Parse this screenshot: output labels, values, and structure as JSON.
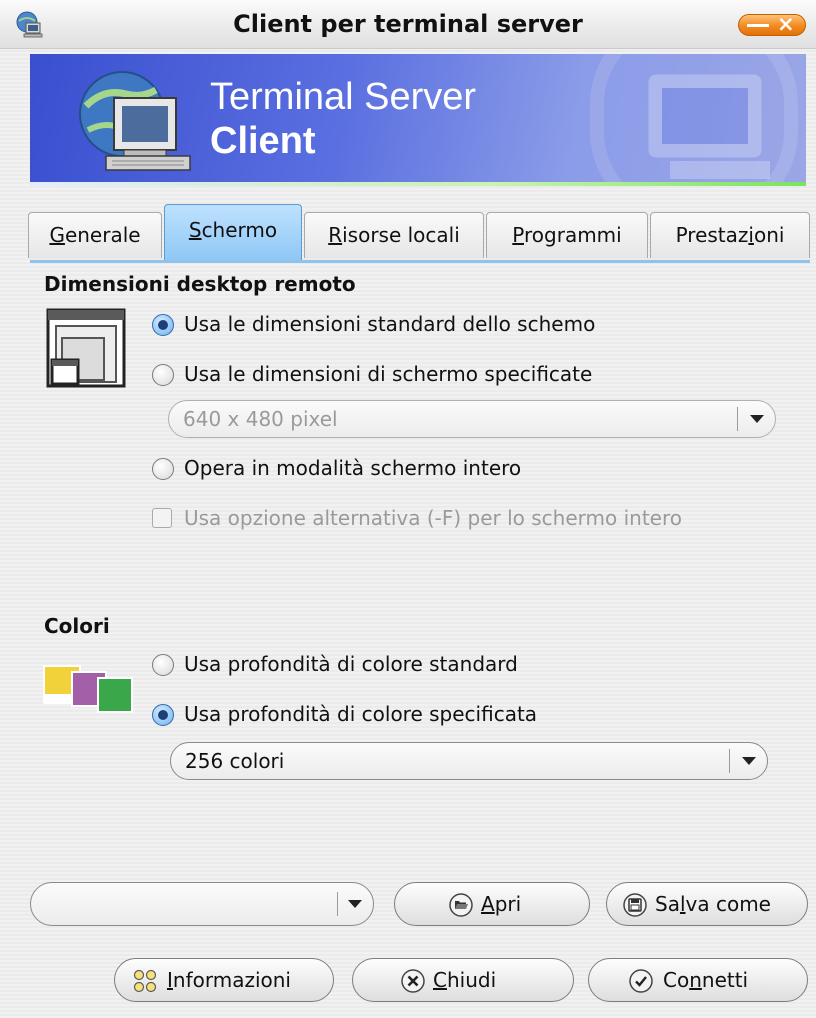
{
  "window": {
    "title": "Client per terminal server"
  },
  "banner": {
    "line1": "Terminal Server",
    "line2": "Client"
  },
  "tabs": [
    {
      "label": "Generale",
      "mnemonic": "G",
      "rest": "enerale",
      "active": false
    },
    {
      "label": "Schermo",
      "mnemonic": "S",
      "rest": "chermo",
      "active": true
    },
    {
      "label": "Risorse locali",
      "mnemonic": "R",
      "rest": "isorse locali",
      "active": false
    },
    {
      "label": "Programmi",
      "mnemonic": "P",
      "rest": "rogrammi",
      "active": false
    },
    {
      "label": "Prestazioni",
      "pre": "Prestaz",
      "mnemonic": "i",
      "rest": "oni",
      "active": false
    }
  ],
  "desktop": {
    "title": "Dimensioni desktop remoto",
    "option_standard": "Usa le dimensioni standard dello schemo",
    "option_standard_checked": true,
    "option_specified": "Usa le dimensioni di schermo specificate",
    "option_specified_checked": false,
    "size_combo": "640 x 480 pixel",
    "option_fullscreen": "Opera in modalità schermo intero",
    "option_fullscreen_checked": false,
    "alt_fullscreen": "Usa opzione alternativa (-F) per lo schermo intero",
    "alt_fullscreen_checked": false
  },
  "colors": {
    "title": "Colori",
    "option_standard": "Usa profondità di colore standard",
    "option_standard_checked": false,
    "option_specified": "Usa profondità di colore specificata",
    "option_specified_checked": true,
    "depth_combo": "256 colori"
  },
  "bottom": {
    "session_combo": "",
    "open_pre": "",
    "open_mnemonic": "A",
    "open_rest": "pri",
    "save_pre": "Sa",
    "save_mnemonic": "l",
    "save_rest": "va come",
    "info_pre": "",
    "info_mnemonic": "I",
    "info_rest": "nformazioni",
    "close_pre": "",
    "close_mnemonic": "C",
    "close_rest": "hiudi",
    "connect_pre": "Co",
    "connect_mnemonic": "n",
    "connect_rest": "netti"
  },
  "icons": {
    "app": "computer-globe-icon",
    "close": "close-icon",
    "screen": "screen-size-icon",
    "colors": "color-depth-icon",
    "open": "open-folder-icon",
    "save": "save-disk-icon",
    "info": "info-stars-icon",
    "close_dialog": "cancel-x-icon",
    "connect": "checkmark-icon"
  }
}
